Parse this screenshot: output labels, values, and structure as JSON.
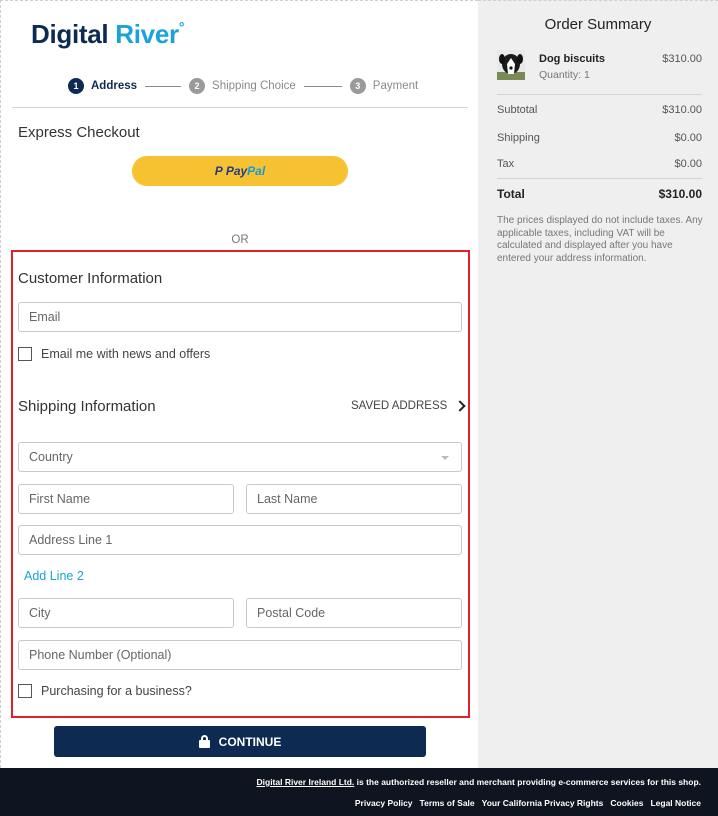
{
  "brand": {
    "name_part1": "Digital ",
    "name_part2": "River",
    "mark": "°"
  },
  "steps": [
    {
      "num": "1",
      "label": "Address"
    },
    {
      "num": "2",
      "label": "Shipping Choice"
    },
    {
      "num": "3",
      "label": "Payment"
    }
  ],
  "express": {
    "title": "Express Checkout",
    "paypal_p": "P",
    "paypal_pay": "Pay",
    "paypal_pal": "Pal",
    "or": "OR"
  },
  "customer": {
    "title": "Customer Information",
    "email_placeholder": "Email",
    "newsletter_label": "Email me with news and offers"
  },
  "shipping": {
    "title": "Shipping Information",
    "saved_address": "SAVED ADDRESS",
    "country_placeholder": "Country",
    "first_name_placeholder": "First Name",
    "last_name_placeholder": "Last Name",
    "address1_placeholder": "Address Line 1",
    "add_line2": "Add Line 2",
    "city_placeholder": "City",
    "postal_placeholder": "Postal Code",
    "phone_placeholder": "Phone Number (Optional)",
    "business_label": "Purchasing for a business?"
  },
  "continue_label": "CONTINUE",
  "summary": {
    "title": "Order Summary",
    "product": {
      "name": "Dog biscuits",
      "quantity": "Quantity: 1",
      "price": "$310.00"
    },
    "rows": [
      {
        "label": "Subtotal",
        "value": "$310.00"
      },
      {
        "label": "Shipping",
        "value": "$0.00"
      },
      {
        "label": "Tax",
        "value": "$0.00"
      }
    ],
    "total": {
      "label": "Total",
      "value": "$310.00"
    },
    "note": "The prices displayed do not include taxes. Any applicable taxes, including VAT will be calculated and displayed after you have entered your address information."
  },
  "footer": {
    "reseller_link": "Digital River Ireland Ltd.",
    "reseller_text": " is the authorized reseller and merchant providing e-commerce services for this shop.",
    "links": [
      "Privacy Policy",
      "Terms of Sale",
      "Your California Privacy Rights",
      "Cookies",
      "Legal Notice"
    ]
  },
  "colors": {
    "navy": "#0d2b52",
    "accent": "#1aa3d8",
    "paypal_yellow": "#f7c232",
    "highlight_border": "#e0202a",
    "footer_bg": "#0e1520"
  }
}
